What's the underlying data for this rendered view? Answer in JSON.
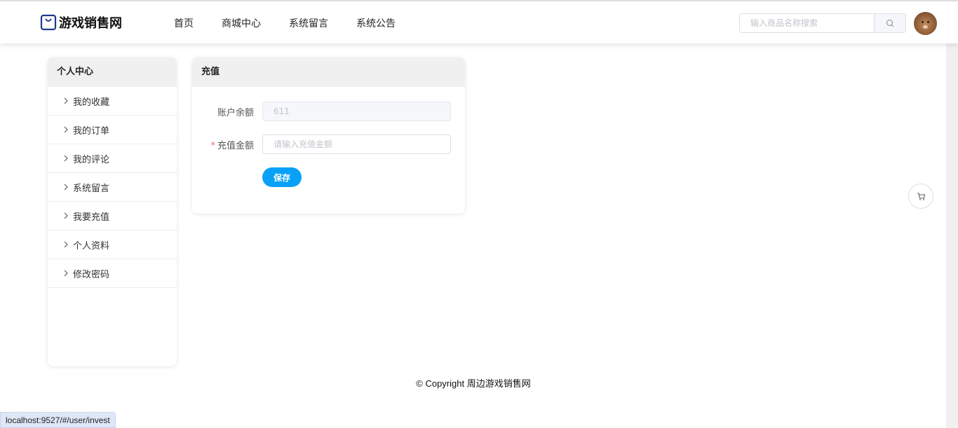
{
  "header": {
    "site_name": "游戏销售网",
    "nav": [
      "首页",
      "商城中心",
      "系统留言",
      "系统公告"
    ],
    "search_placeholder": "输入商品名称搜索"
  },
  "sidebar": {
    "title": "个人中心",
    "items": [
      "我的收藏",
      "我的订单",
      "我的评论",
      "系统留言",
      "我要充值",
      "个人资料",
      "修改密码"
    ]
  },
  "recharge": {
    "title": "充值",
    "balance_label": "账户余额",
    "balance_value": "611",
    "amount_label": "充值金额",
    "required_mark": "*",
    "amount_placeholder": "请输入充值金额",
    "save_label": "保存"
  },
  "footer": {
    "copyright": "© Copyright 周边游戏销售网"
  },
  "status_bar": {
    "url": "localhost:9527/#/user/invest"
  },
  "colors": {
    "primary": "#09a1f7",
    "logo": "#1a3a8a",
    "required": "#f56c6c"
  }
}
